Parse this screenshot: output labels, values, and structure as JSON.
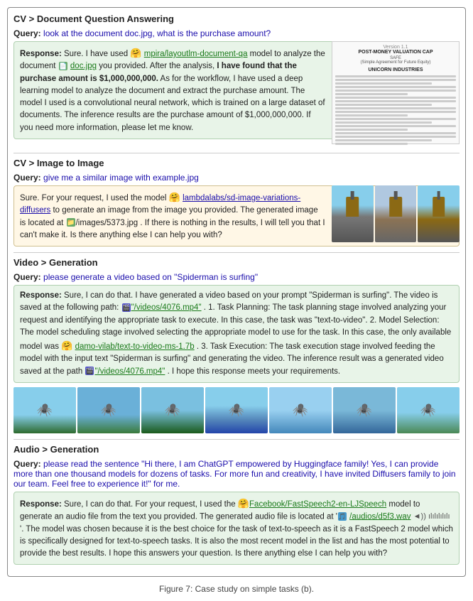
{
  "breadcrumb1": "CV > Document Question Answering",
  "dqa": {
    "query_label": "Query:",
    "query_text": "look at the document doc.jpg, what is the purchase amount?",
    "response_label": "Response:",
    "response_text1": "Sure. I have used ",
    "model1": "mpira/layoutlm-document-qa",
    "response_text2": " model to analyze the document ",
    "file1": "doc.jpg",
    "response_text3": " you provided. After the analysis, ",
    "highlight1": "I have found that the purchase amount is $1,000,000,000.",
    "response_text4": " As for the workflow, I have used a deep learning model to analyze the document and extract the purchase amount. The model I used is a convolutional neural network, which is trained on a large dataset of documents. The inference results are the purchase amount of $1,000,000,000. If you need more information, please let me know.",
    "doc_title": "POST-MONEY VALUATION CAP",
    "doc_subtitle": "SAFE",
    "doc_sub2": "(Simple Agreement for Future Equity)",
    "doc_company": "UNICORN INDUSTRIES"
  },
  "breadcrumb2": "CV > Image to Image",
  "i2i": {
    "query_label": "Query:",
    "query_text": "give me a similar image with example.jpg",
    "response_label": "Response:",
    "response_text1": "Sure. For your request, I used the model ",
    "model1": "lambdalabs/sd-image-variations-diffusers",
    "response_text2": " to generate an image from the image you provided. The generated image is located at ",
    "file1": "/images/5373.jpg",
    "response_text3": ". If there is nothing in the results, I will tell you that I can't make it. Is there anything else I can help you with?"
  },
  "breadcrumb3": "Video > Generation",
  "vidgen": {
    "query_label": "Query:",
    "query_text": "please generate a video based on \"Spiderman is surfing\"",
    "response_label": "Response:",
    "response_text1": "Sure, I can do that. I have generated a video based on your prompt \"Spiderman is surfing\". The video is saved at the following path: ",
    "file1": "\"/videos/4076.mp4\"",
    "response_text2": ". 1. Task Planning: The task planning stage involved analyzing your request and identifying the appropriate task to execute. In this case, the task was \"text-to-video\". 2. Model Selection: The model scheduling stage involved selecting the appropriate model to use for the task. In this case, the only available model was ",
    "model1": "damo-vilab/text-to-video-ms-1.7b",
    "response_text3": ". 3. Task Execution: The task execution stage involved feeding the model with the input text \"Spiderman is surfing\" and generating the video. The inference result was a generated video saved at the path ",
    "file2": "\"/videos/4076.mp4\"",
    "response_text4": ". I hope this response meets your requirements.",
    "frames": [
      "🕷️",
      "🕷️",
      "🕷️",
      "🕷️",
      "🕷️",
      "🕷️",
      "🕷️"
    ]
  },
  "breadcrumb4": "Audio > Generation",
  "audiogen": {
    "query_label": "Query:",
    "query_text": "please read the sentence \"Hi there, I am ChatGPT empowered by Huggingface family! Yes, I can provide more than one thousand models for dozens of tasks. For more fun and creativity, I have invited Diffusers family to join our team. Feel free to experience it!\" for me.",
    "response_label": "Response:",
    "response_text1": "Sure, I can do that. For your request, I used the ",
    "model1": "Facebook/FastSpeech2-en-LJSpeech",
    "response_text2": " model to generate an audio file from the text you provided. The generated audio file is located at '",
    "file1": "/audios/d5f3.wav",
    "audio_wave": "◄)) ılılılılılı",
    "response_text3": "'. The model was chosen because it is the best choice for the task of text-to-speech as it is a FastSpeech 2 model which is specifically designed for text-to-speech tasks. It is also the most recent model in the list and has the most potential to provide the best results. I hope this answers your question. Is there anything else I can help you with?",
    "model_note": "The model"
  },
  "figure_caption": "Figure 7: Case study on simple tasks (b)."
}
